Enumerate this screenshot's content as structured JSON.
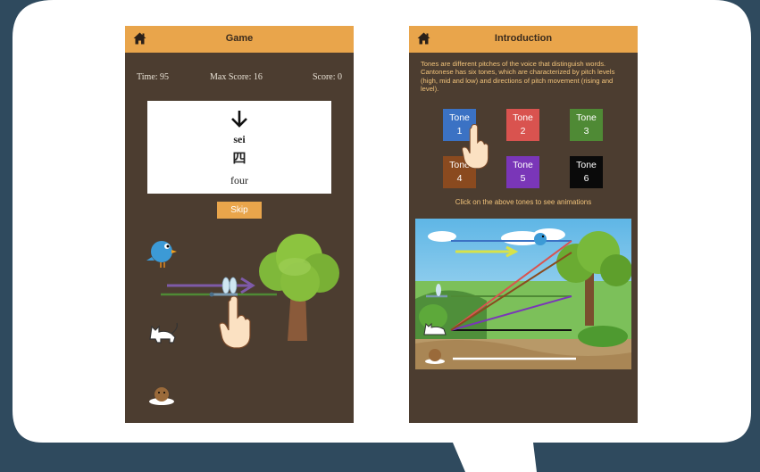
{
  "game_screen": {
    "header": {
      "title": "Game"
    },
    "stats": {
      "time": "Time: 95",
      "max_score": "Max Score: 16",
      "score": "Score: 0"
    },
    "card": {
      "romanization": "sei",
      "character": "四",
      "meaning": "four"
    },
    "skip_label": "Skip"
  },
  "intro_screen": {
    "header": {
      "title": "Introduction"
    },
    "description": "Tones are different pitches of the voice that distinguish words. Cantonese has six tones, which are characterized by pitch levels (high, mid and low) and directions of pitch movement (rising and level).",
    "tones": [
      {
        "label": "Tone",
        "number": "1",
        "color": "#3b72c4"
      },
      {
        "label": "Tone",
        "number": "2",
        "color": "#d9534f"
      },
      {
        "label": "Tone",
        "number": "3",
        "color": "#4f8a35"
      },
      {
        "label": "Tone",
        "number": "4",
        "color": "#8a4a1f"
      },
      {
        "label": "Tone",
        "number": "5",
        "color": "#7a36b8"
      },
      {
        "label": "Tone",
        "number": "6",
        "color": "#0a0a0a"
      }
    ],
    "hint": "Click on the above tones to see animations"
  },
  "colors": {
    "accent": "#e9a54b",
    "screen_bg": "#4c3d30",
    "page_bg": "#2f4a5e"
  }
}
